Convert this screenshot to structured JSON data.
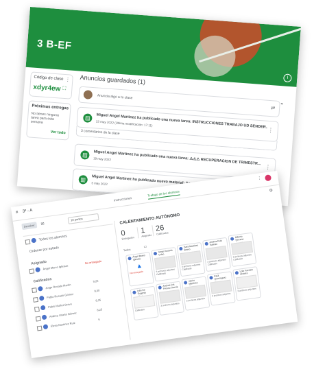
{
  "top": {
    "class_title": "3 B-EF",
    "code_card": {
      "label": "Código de clase",
      "code": "xdyr4ew"
    },
    "upcoming": {
      "title": "Próximas entregas",
      "empty": "No tienes ninguna tarea para esta semana",
      "link": "Ver todo"
    },
    "saved": {
      "title": "Anuncios guardados (1)"
    },
    "compose": {
      "placeholder": "Anuncia algo a tu clase"
    },
    "posts": [
      {
        "title": "Miguel Angel Martinez ha publicado una nueva tarea: INSTRUCCIONES TRABAJO UD SENDER...",
        "date": "22 may 2022 (Última modificación: 17:11)"
      },
      {
        "title": "Miguel Angel Martinez ha publicado una nueva tarea: ⚠⚠⚠ RECUPERACIÓN DE TRIMESTR...",
        "date": "19 may 2022"
      },
      {
        "title": "Miguel Angel Martinez ha publicado nuevo material: Apuntes UD...",
        "date": "5 may 2022"
      }
    ],
    "comments": "3 comentarios de la clase"
  },
  "bottom": {
    "window_title": "3º - A",
    "tabs": [
      "Instrucciones",
      "Trabajo de los alumnos"
    ],
    "sort": "Ordenar por estado",
    "toolbar": {
      "button": "Devolver",
      "points": "10 puntos"
    },
    "all_students": "Todos los alumnos",
    "section_assigned": "Asignado",
    "section_graded": "Calificados",
    "student_rows": [
      {
        "name": "Ángel Marco Iglesias",
        "status": "No entregado",
        "grade": ""
      },
      {
        "name": "Jorge Rosado Martín",
        "status": "",
        "grade": "9,25"
      },
      {
        "name": "Pablo Rosado Gómez",
        "status": "",
        "grade": "8,00"
      },
      {
        "name": "Pablo Muñoz Bravo",
        "status": "",
        "grade": "8,25"
      },
      {
        "name": "Andrea Uriarte Gómez",
        "status": "",
        "grade": "8,25"
      },
      {
        "name": "Elena Martínez Ruiz",
        "status": "",
        "grade": "9"
      }
    ],
    "assignment_title": "CALENTAMIENTO AUTÓNOMO",
    "stats": [
      {
        "n": "0",
        "l": "Entregados"
      },
      {
        "n": "1",
        "l": "Asignado"
      },
      {
        "n": "26",
        "l": "Calificados"
      }
    ],
    "filter": "Todos",
    "tiles_row1": [
      "Ángel Bravo Iglesias",
      "Jorge Rosado Cobo",
      "Sara Martínez Bravo",
      "Andrea Ruiz Salinas",
      "Alberto Serrano Rosario"
    ],
    "tiles_row2": [
      "Iván De Eugenio Martínez",
      "Andrea Del Fresno García",
      "Javier Martínez Castro",
      "Raúl Domínguez Ramos",
      "Lola Fuentes Álvarez"
    ],
    "tile_caption": "3 archivos adjuntos",
    "tile_status": "Calificado",
    "late": "No entregado"
  }
}
